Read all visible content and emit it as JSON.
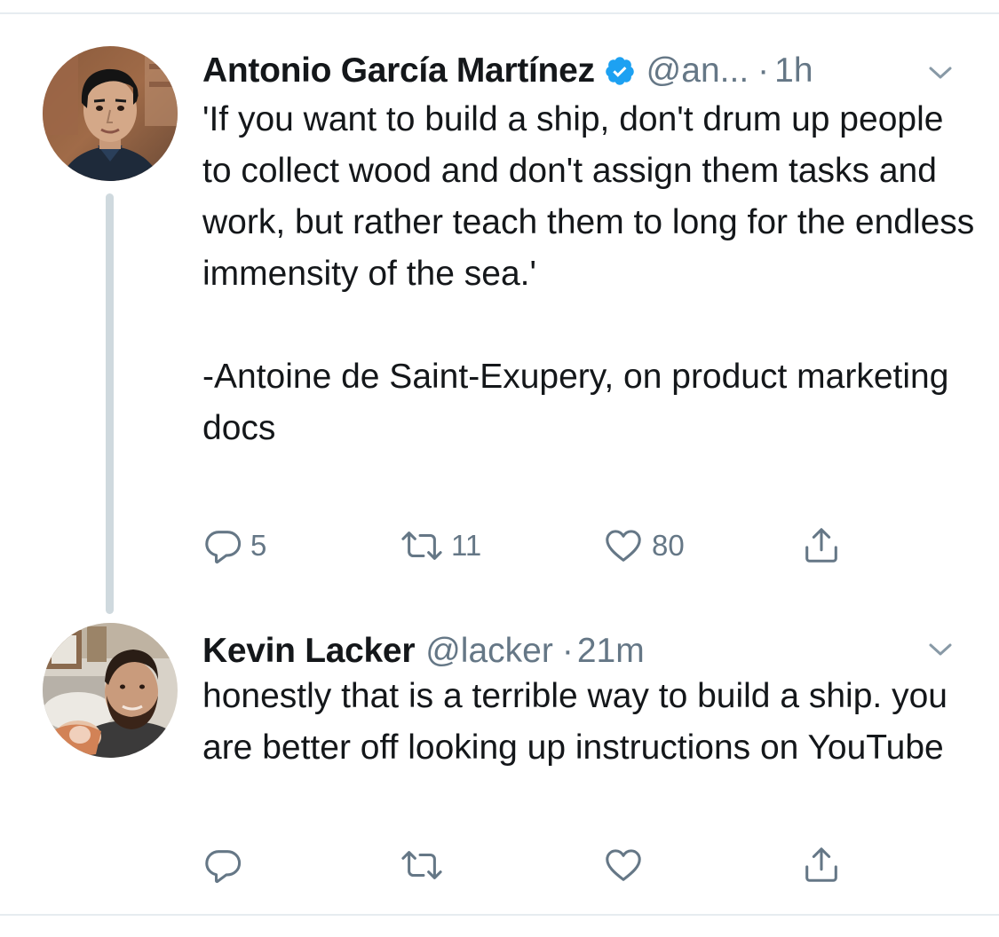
{
  "thread": {
    "tweets": [
      {
        "author_name": "Antonio García Martínez",
        "verified": true,
        "handle": "@an...",
        "separator": "·",
        "time": "1h",
        "text": "'If you want to build a ship, don't drum up people to collect wood and don't assign them tasks and work, but rather teach them to long for the endless immensity of the sea.'\n\n-Antoine de Saint-Exupery, on product marketing docs",
        "actions": {
          "reply_count": "5",
          "retweet_count": "11",
          "like_count": "80"
        }
      },
      {
        "author_name": "Kevin Lacker",
        "verified": false,
        "handle": "@lacker",
        "separator": "·",
        "time": "21m",
        "text": "honestly that is a terrible way to build a ship. you are better off looking up instructions on YouTube",
        "actions": {
          "reply_count": "",
          "retweet_count": "",
          "like_count": ""
        }
      }
    ]
  },
  "icons": {
    "verified": "verified-badge-icon",
    "chevron": "chevron-down-icon",
    "reply": "reply-icon",
    "retweet": "retweet-icon",
    "like": "heart-icon",
    "share": "share-icon"
  },
  "colors": {
    "text": "#14171a",
    "secondary": "#657786",
    "verified": "#1da1f2",
    "thread_line": "#cfd9de",
    "divider": "#e6ecf0"
  }
}
